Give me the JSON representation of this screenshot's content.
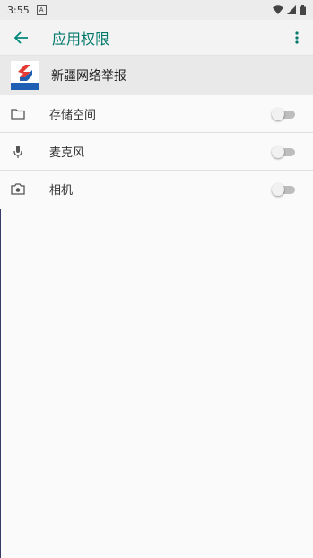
{
  "status": {
    "time": "3:55",
    "notif": "A"
  },
  "appbar": {
    "title": "应用权限"
  },
  "app": {
    "name": "新疆网络举报",
    "logo_colors": {
      "blue": "#1e5fb4",
      "red": "#e53935"
    }
  },
  "permissions": [
    {
      "label": "存储空间",
      "icon": "folder-icon",
      "enabled": false
    },
    {
      "label": "麦克风",
      "icon": "microphone-icon",
      "enabled": false
    },
    {
      "label": "相机",
      "icon": "camera-icon",
      "enabled": false
    }
  ],
  "colors": {
    "accent": "#00796b"
  }
}
